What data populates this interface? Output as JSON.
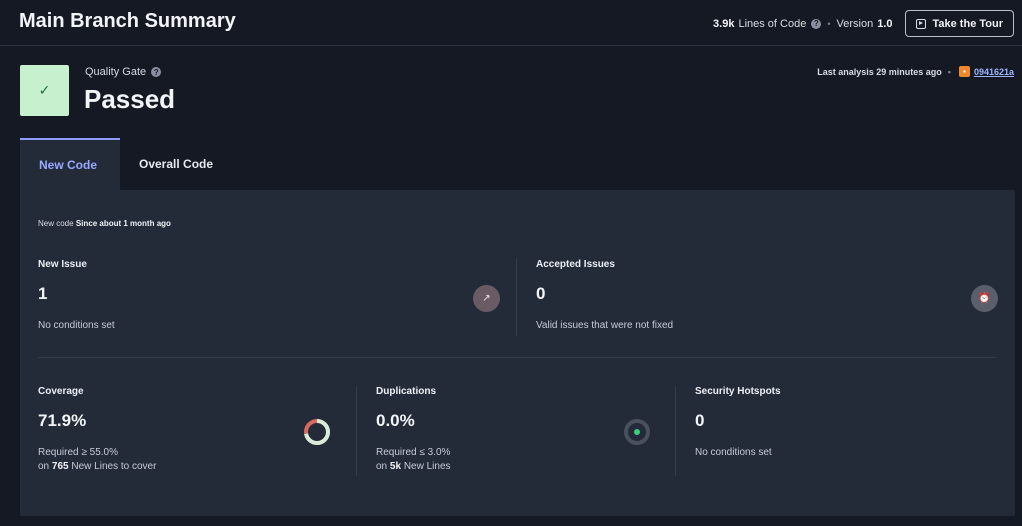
{
  "header": {
    "title": "Main Branch Summary",
    "loc_value": "3.9k",
    "loc_label": "Lines of Code",
    "version_label": "Version",
    "version_value": "1.0",
    "tour_button": "Take the Tour"
  },
  "quality_gate": {
    "label": "Quality Gate",
    "status": "Passed",
    "last_analysis": "Last analysis 29 minutes ago",
    "commit_hash": "0941621a"
  },
  "tabs": [
    {
      "label": "New Code",
      "active": true
    },
    {
      "label": "Overall Code",
      "active": false
    }
  ],
  "new_code": {
    "since_prefix": "New code",
    "since_value": "Since about 1 month ago"
  },
  "issues": {
    "new_issue": {
      "title": "New Issue",
      "value": "1",
      "sub": "No conditions set"
    },
    "accepted": {
      "title": "Accepted Issues",
      "value": "0",
      "sub": "Valid issues that were not fixed"
    }
  },
  "metrics": {
    "coverage": {
      "title": "Coverage",
      "value": "71.9%",
      "required": "Required ≥ 55.0%",
      "on": "on",
      "lines": "765",
      "lines_label": "New Lines to cover",
      "percent": 71.9
    },
    "duplications": {
      "title": "Duplications",
      "value": "0.0%",
      "required": "Required ≤ 3.0%",
      "on": "on",
      "lines": "5k",
      "lines_label": "New Lines"
    },
    "hotspots": {
      "title": "Security Hotspots",
      "value": "0",
      "sub": "No conditions set"
    }
  },
  "colors": {
    "accent": "#8e9cff",
    "passed_bg": "#c7f0cf",
    "coverage_covered": "#d7ecd9",
    "coverage_uncovered": "#d9695f",
    "duplication_dot": "#3ad07a"
  }
}
